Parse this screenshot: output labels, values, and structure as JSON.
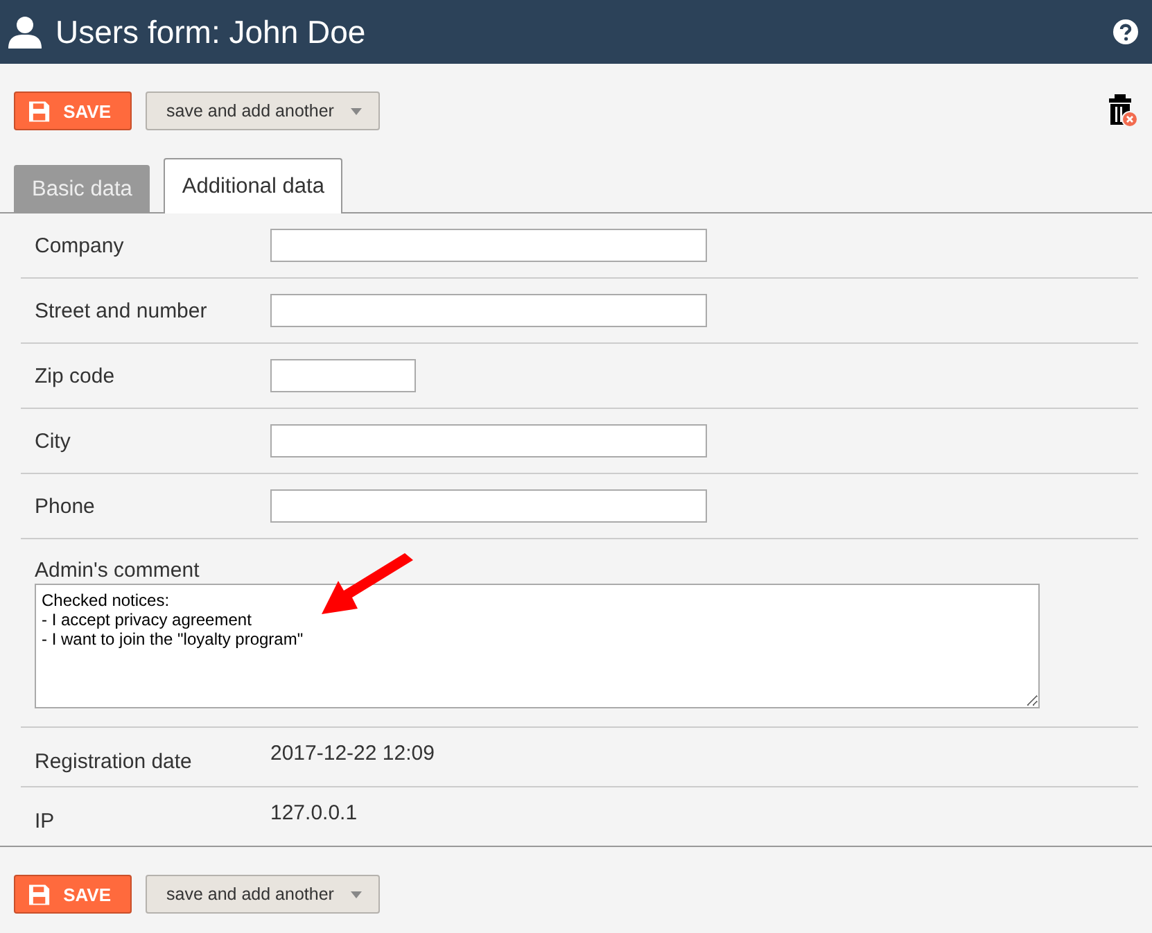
{
  "window": {
    "title": "Users form: John Doe"
  },
  "toolbar": {
    "save": "SAVE",
    "save_another": "save and add another"
  },
  "tabs": [
    {
      "label": "Basic data",
      "selected": false
    },
    {
      "label": "Additional data",
      "selected": true
    }
  ],
  "fields": [
    {
      "kind": "text",
      "label": "Company"
    },
    {
      "kind": "text",
      "label": "Street and number"
    },
    {
      "kind": "short",
      "label": "Zip code"
    },
    {
      "kind": "text",
      "label": "City"
    },
    {
      "kind": "text",
      "label": "Phone"
    },
    {
      "kind": "textarea",
      "label": "Admin's comment",
      "value": "Checked notices:\n- I accept privacy agreement\n- I want to join the \"loyalty program\""
    },
    {
      "kind": "static",
      "label": "Registration date",
      "value": "2017-12-22 12:09"
    },
    {
      "kind": "static",
      "label": "IP",
      "value": "127.0.0.1"
    }
  ],
  "footer": {
    "save": "SAVE",
    "save_another": "save and add another"
  }
}
